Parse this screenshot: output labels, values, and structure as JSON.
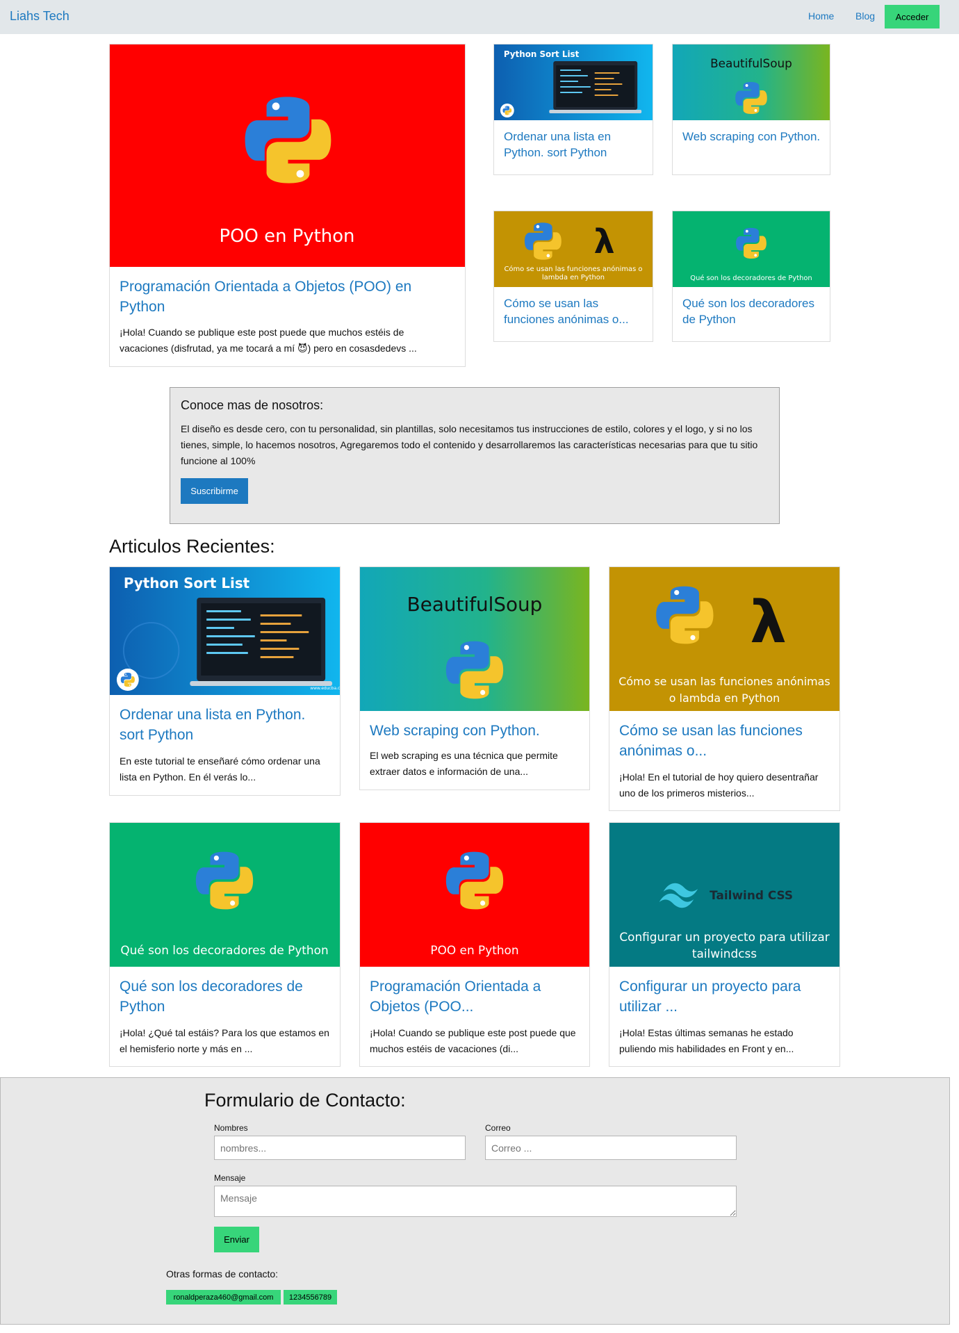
{
  "navbar": {
    "brand": "Liahs Tech",
    "links": [
      "Home",
      "Blog"
    ],
    "login_button": "Acceder"
  },
  "colors": {
    "accent": "#1d79c0",
    "green": "#37d57a",
    "nav_bg": "#e2e7ea",
    "panel_bg": "#e8e8e8"
  },
  "featured": {
    "main": {
      "image_text": "POO en Python",
      "title": "Programación Orientada a Objetos (POO) en Python",
      "excerpt": "¡Hola! Cuando se publique este post puede que muchos estéis de vacaciones (disfrutad, ya me tocará a mí 😈) pero en cosasdedevs ..."
    },
    "side": [
      {
        "image_text": "Python Sort List",
        "title": "Ordenar una lista en Python. sort Python"
      },
      {
        "image_text": "BeautifulSoup",
        "title": "Web scraping con Python."
      },
      {
        "image_text": "Cómo se usan las funciones anónimas o lambda en Python",
        "title": "Cómo se usan las funciones anónimas o..."
      },
      {
        "image_text": "Qué son los decoradores de Python",
        "title": "Qué son los decoradores de Python"
      }
    ]
  },
  "about": {
    "title": "Conoce mas de nosotros:",
    "text": "El diseño es desde cero, con tu personalidad, sin plantillas, solo necesitamos tus instrucciones de estilo, colores y el logo, y si no los tienes, simple, lo hacemos nosotros, Agregaremos todo el contenido y desarrollaremos las características necesarias para que tu sitio funcione al 100%",
    "button": "Suscribirme"
  },
  "recent": {
    "title": "Articulos Recientes:",
    "articles": [
      {
        "image_text": "Python Sort List",
        "title": "Ordenar una lista en Python. sort Python",
        "excerpt": "En este tutorial te enseñaré cómo ordenar una lista en Python. En él verás lo..."
      },
      {
        "image_text": "BeautifulSoup",
        "title": "Web scraping con Python.",
        "excerpt": "El web scraping es una técnica que permite extraer datos e información de una..."
      },
      {
        "image_text": "Cómo se usan las funciones anónimas o lambda en Python",
        "title": "Cómo se usan las funciones anónimas o...",
        "excerpt": "¡Hola! En el tutorial de hoy quiero desentrañar uno de los primeros misterios..."
      },
      {
        "image_text": "Qué son los decoradores de Python",
        "title": "Qué son los decoradores de Python",
        "excerpt": "¡Hola! ¿Qué tal estáis? Para los que estamos en el hemisferio norte y más en ..."
      },
      {
        "image_text": "POO en Python",
        "title": "Programación Orientada a Objetos (POO...",
        "excerpt": "¡Hola! Cuando se publique este post puede que muchos estéis de vacaciones (di..."
      },
      {
        "image_text": "Configurar un proyecto para utilizar tailwindcss",
        "image_brand": "Tailwind CSS",
        "title": "Configurar un proyecto para utilizar ...",
        "excerpt": "¡Hola! Estas últimas semanas he estado puliendo mis habilidades en Front y en..."
      }
    ]
  },
  "contact": {
    "title": "Formulario de Contacto:",
    "name_label": "Nombres",
    "name_placeholder": "nombres...",
    "email_label": "Correo",
    "email_placeholder": "Correo ...",
    "message_label": "Mensaje",
    "message_placeholder": "Mensaje",
    "submit": "Enviar",
    "other_label": "Otras formas de contacto:",
    "email": "ronaldperaza460@gmail.com",
    "phone": "1234556789"
  }
}
